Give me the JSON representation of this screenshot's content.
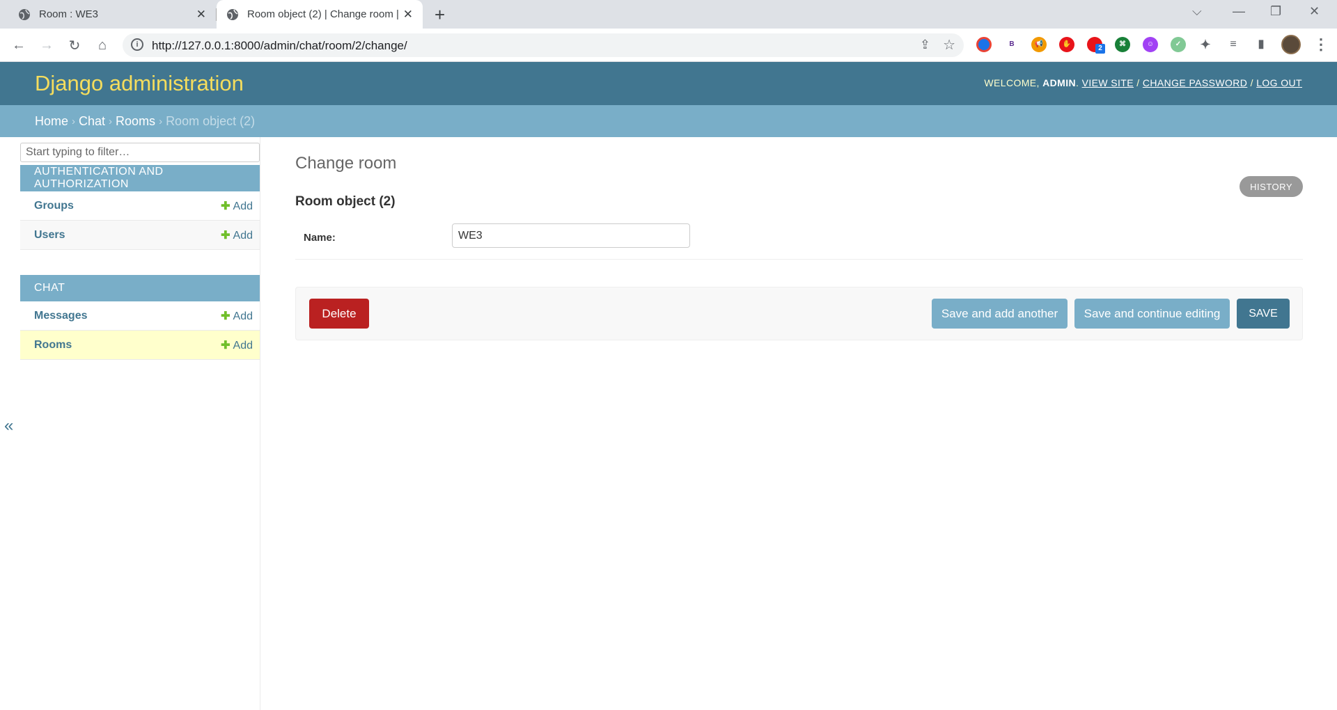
{
  "browser": {
    "tabs": [
      {
        "title": "Room : WE3"
      },
      {
        "title": "Room object (2) | Change room |"
      }
    ],
    "url": "http://127.0.0.1:8000/admin/chat/room/2/change/",
    "extension_badge": "2",
    "extension_b": "B"
  },
  "header": {
    "branding": "Django administration",
    "welcome": "WELCOME, ",
    "username": "ADMIN",
    "view_site": "VIEW SITE",
    "change_password": "CHANGE PASSWORD",
    "log_out": "LOG OUT"
  },
  "breadcrumbs": {
    "home": "Home",
    "app": "Chat",
    "model": "Rooms",
    "current": "Room object (2)"
  },
  "sidebar": {
    "filter_placeholder": "Start typing to filter…",
    "modules": [
      {
        "caption": "AUTHENTICATION AND AUTHORIZATION",
        "rows": [
          {
            "model": "Groups",
            "add": "Add"
          },
          {
            "model": "Users",
            "add": "Add"
          }
        ]
      },
      {
        "caption": "CHAT",
        "rows": [
          {
            "model": "Messages",
            "add": "Add"
          },
          {
            "model": "Rooms",
            "add": "Add"
          }
        ]
      }
    ],
    "collapse": "«"
  },
  "content": {
    "title": "Change room",
    "history": "HISTORY",
    "object_title": "Room object (2)",
    "name_label": "Name:",
    "name_value": "WE3",
    "delete": "Delete",
    "save_add_another": "Save and add another",
    "save_continue": "Save and continue editing",
    "save": "SAVE"
  }
}
